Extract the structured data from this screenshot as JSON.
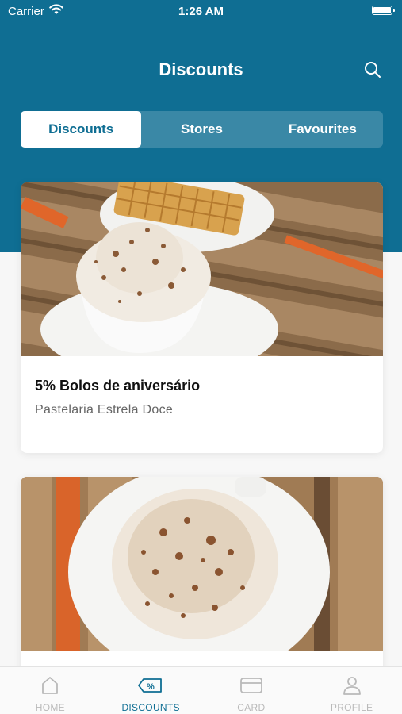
{
  "status_bar": {
    "carrier": "Carrier",
    "time": "1:26 AM"
  },
  "nav": {
    "title": "Discounts",
    "search_icon": "search-icon"
  },
  "segments": [
    {
      "label": "Discounts",
      "active": true
    },
    {
      "label": "Stores",
      "active": false
    },
    {
      "label": "Favourites",
      "active": false
    }
  ],
  "cards": [
    {
      "title": "5% Bolos de aniversário",
      "subtitle": "Pastelaria Estrela Doce",
      "image": "waffle-and-coffee-photo"
    },
    {
      "title": "",
      "subtitle": "",
      "image": "coffee-cream-photo"
    }
  ],
  "tabbar": [
    {
      "label": "HOME",
      "icon": "home-icon",
      "active": false
    },
    {
      "label": "DISCOUNTS",
      "icon": "discount-tag-icon",
      "active": true
    },
    {
      "label": "CARD",
      "icon": "card-icon",
      "active": false
    },
    {
      "label": "PROFILE",
      "icon": "profile-icon",
      "active": false
    }
  ],
  "colors": {
    "primary": "#0f6e93",
    "inactive": "#b9b9b9"
  }
}
